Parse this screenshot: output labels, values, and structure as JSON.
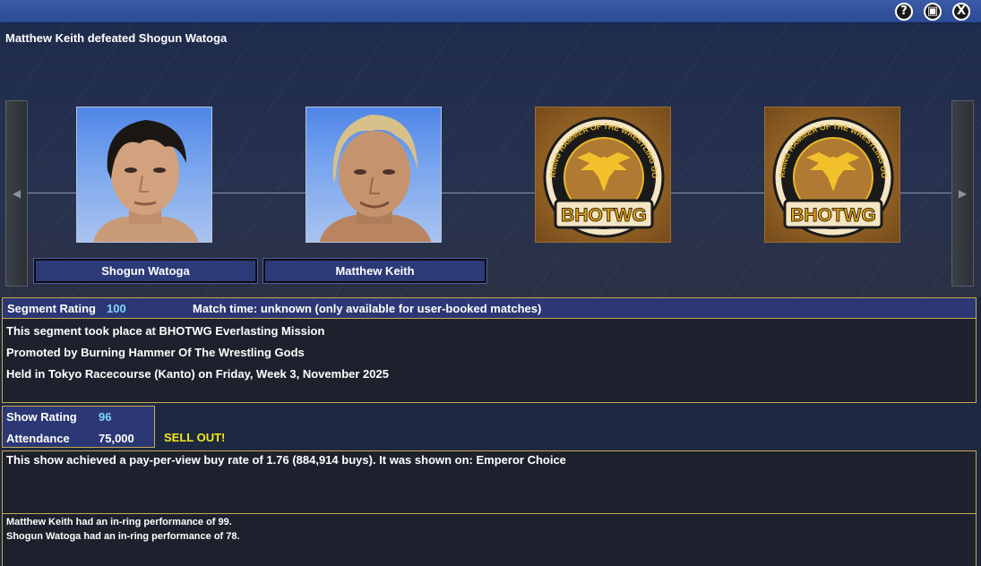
{
  "window": {
    "buttons": {
      "help": "?",
      "minimize": "▣",
      "close": "X"
    }
  },
  "headline": "Matthew Keith defeated Shogun Watoga",
  "nav": {
    "left_arrow": "◀",
    "right_arrow": "▶"
  },
  "participants": [
    {
      "name": "Shogun Watoga"
    },
    {
      "name": "Matthew Keith"
    }
  ],
  "logos": [
    {
      "top_text": "BURNING HAMMER OF THE WRESTLING GODS",
      "badge_text": "BHOTWG"
    },
    {
      "top_text": "BURNING HAMMER OF THE WRESTLING GODS",
      "badge_text": "BHOTWG"
    }
  ],
  "segment": {
    "rating_label": "Segment Rating",
    "rating_value": "100",
    "match_time": "Match time: unknown (only available for user-booked matches)",
    "lines": [
      "This segment took place at BHOTWG Everlasting Mission",
      "Promoted by Burning Hammer Of The Wrestling Gods",
      "Held in Tokyo Racecourse (Kanto) on Friday, Week 3, November 2025"
    ]
  },
  "show": {
    "rating_label": "Show Rating",
    "rating_value": "96",
    "attendance_label": "Attendance",
    "attendance_value": "75,000",
    "sellout": "SELL OUT!"
  },
  "ppv": "This show achieved a pay-per-view buy rate of 1.76 (884,914 buys). It was shown on: Emperor Choice",
  "performances": [
    "Matthew Keith had an in-ring performance of 99.",
    "Shogun Watoga had an in-ring performance of 78."
  ],
  "colors": {
    "accent_value": "#7fd6f8",
    "sellout": "#f2ea14",
    "panel_border": "#c9a84f",
    "header_blue": "#2b3875"
  }
}
